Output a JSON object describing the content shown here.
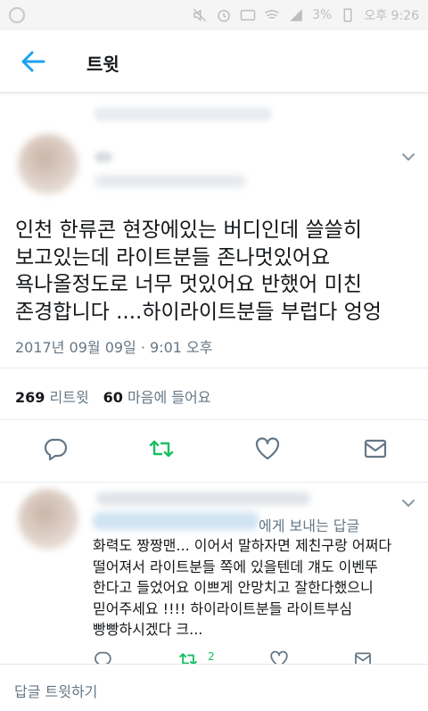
{
  "status_bar": {
    "battery_percent": "3%",
    "time": "오후 9:26"
  },
  "header": {
    "title": "트윗"
  },
  "tweet": {
    "text_lines": [
      "인천 한류콘 현장에있는 버디인데 쓸쓸히",
      "보고있는데 라이트분들 존나멋있어요",
      "욕나올정도로 너무 멋있어요 반했어 미친",
      "존경합니다 ....하이라이트분들 부럽다 엉엉"
    ],
    "timestamp": "2017년 09월 09일 · 9:01 오후",
    "retweet_count": "269",
    "retweet_label": "리트윗",
    "like_count": "60",
    "like_label": "마음에 들어요"
  },
  "reply": {
    "reply_to_suffix": "에게 보내는 답글",
    "text_lines": [
      "화력도 짱짱맨... 이어서 말하자면 제친구랑 어쩌다",
      "떨어져서 라이트분들 쪽에 있을텐데 걔도 이벤뚜",
      "한다고 들었어요 이쁘게 안망치고 잘한다했으니",
      "믿어주세요 !!!! 하이라이트분들 라이트부심",
      "빵빵하시겠다 크..."
    ],
    "retweet_count": "2"
  },
  "reply_bar": {
    "placeholder": "답글 트윗하기"
  },
  "icons": {
    "back": "arrow-left-icon",
    "caret": "chevron-down-icon",
    "reply": "comment-bubble-icon",
    "retweet": "retweet-icon",
    "like": "heart-icon",
    "dm": "envelope-icon"
  },
  "colors": {
    "accent": "#1da1f2",
    "retweet_active": "#17bf63",
    "secondary_text": "#657786",
    "action_icon": "#657786"
  }
}
